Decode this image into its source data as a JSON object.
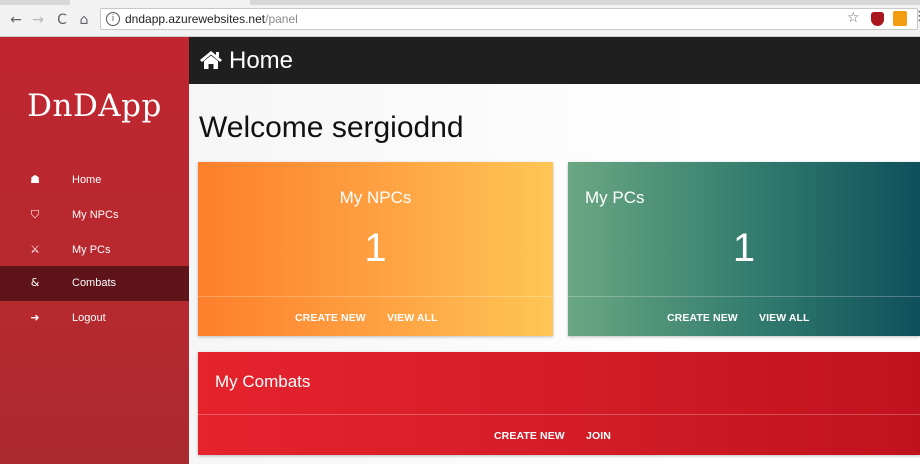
{
  "browser": {
    "back_glyph": "←",
    "forward_glyph": "→",
    "reload_glyph": "C",
    "home_glyph": "⌂",
    "info_glyph": "i",
    "url_host": "dndapp.azurewebsites.net",
    "url_path": "/panel",
    "star_glyph": "☆",
    "menu_glyph": "⋮"
  },
  "sidebar": {
    "brand": "DnDApp",
    "items": [
      {
        "label": "Home",
        "icon": "home-icon",
        "glyph": "☗"
      },
      {
        "label": "My NPCs",
        "icon": "shield-icon",
        "glyph": "⛉"
      },
      {
        "label": "My PCs",
        "icon": "sword-icon",
        "glyph": "⚔"
      },
      {
        "label": "Combats",
        "icon": "ampersand-icon",
        "glyph": "&"
      },
      {
        "label": "Logout",
        "icon": "logout-icon",
        "glyph": "➜"
      }
    ],
    "active_index": 3
  },
  "topbar": {
    "title": "Home"
  },
  "main": {
    "welcome": "Welcome sergiodnd",
    "cards": {
      "npcs": {
        "title": "My NPCs",
        "count": "1",
        "create_label": "CREATE NEW",
        "view_label": "VIEW ALL"
      },
      "pcs": {
        "title": "My PCs",
        "count": "1",
        "create_label": "CREATE NEW",
        "view_label": "VIEW ALL"
      },
      "combats": {
        "title": "My Combats",
        "create_label": "CREATE NEW",
        "join_label": "JOIN"
      }
    }
  },
  "colors": {
    "sidebar_bg": "#b7292f",
    "sidebar_active": "#5e1419",
    "topbar_bg": "#1f1f1f",
    "npcs_gradient": [
      "#fd7f2c",
      "#fec656"
    ],
    "pcs_gradient": [
      "#6aa783",
      "#0f4f5c"
    ],
    "combats_gradient": [
      "#e5232d",
      "#c0121d"
    ]
  }
}
